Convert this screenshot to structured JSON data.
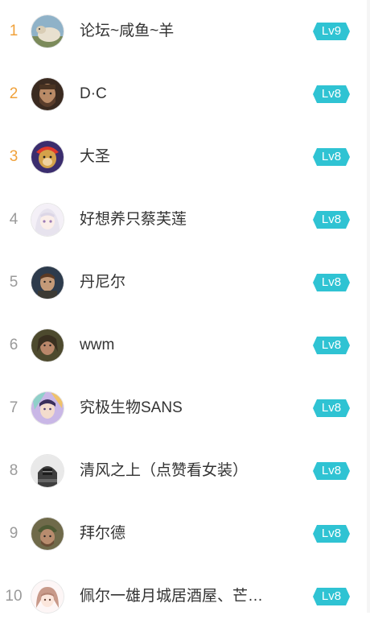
{
  "colors": {
    "top_rank": "#f0a13a",
    "rank": "#9a9a9a",
    "badge": "#2fc3d3",
    "name": "#333333"
  },
  "ranking": [
    {
      "rank": "1",
      "name": "论坛~咸鱼~羊",
      "level": "Lv9",
      "avatar": "sheep-avatar-icon"
    },
    {
      "rank": "2",
      "name": "D·C",
      "level": "Lv8",
      "avatar": "bearded-man-avatar-icon"
    },
    {
      "rank": "3",
      "name": "大圣",
      "level": "Lv8",
      "avatar": "monkey-king-avatar-icon"
    },
    {
      "rank": "4",
      "name": "好想养只蔡芙莲",
      "level": "Lv8",
      "avatar": "anime-girl-avatar-icon"
    },
    {
      "rank": "5",
      "name": "丹尼尔",
      "level": "Lv8",
      "avatar": "man-portrait-avatar-icon"
    },
    {
      "rank": "6",
      "name": "wwm",
      "level": "Lv8",
      "avatar": "warrior-avatar-icon"
    },
    {
      "rank": "7",
      "name": "究极生物SANS",
      "level": "Lv8",
      "avatar": "anime-character-avatar-icon"
    },
    {
      "rank": "8",
      "name": "清风之上（点赞看女装）",
      "level": "Lv8",
      "avatar": "armored-knight-avatar-icon"
    },
    {
      "rank": "9",
      "name": "拜尔德",
      "level": "Lv8",
      "avatar": "soldier-avatar-icon"
    },
    {
      "rank": "10",
      "name": "佩尔一雄月城居酒屋、芒…",
      "level": "Lv8",
      "avatar": "chibi-girl-avatar-icon"
    }
  ]
}
